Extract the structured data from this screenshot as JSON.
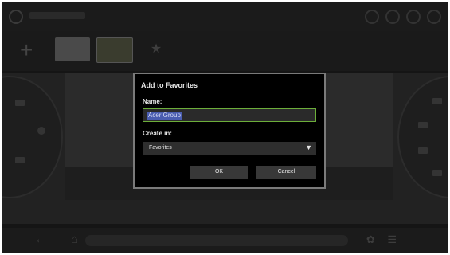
{
  "dialog": {
    "title": "Add to Favorites",
    "name_label": "Name:",
    "name_value": "Acer Group",
    "create_in_label": "Create in:",
    "create_in_value": "Favorites",
    "ok_label": "OK",
    "cancel_label": "Cancel"
  },
  "icons": {
    "dropdown_arrow": "▼",
    "new_tab": "+",
    "back": "←",
    "home": "⌂",
    "bottom_right": "✿ ☰"
  }
}
